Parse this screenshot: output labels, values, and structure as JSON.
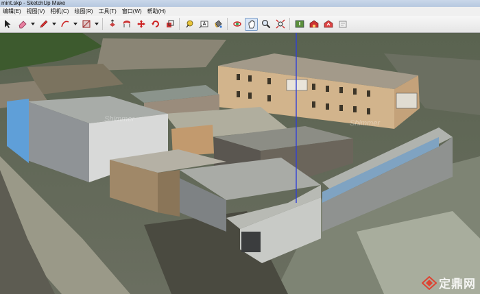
{
  "window": {
    "title": "mint.skp - SketchUp Make"
  },
  "menu": [
    "编辑(E)",
    "视图(V)",
    "相机(C)",
    "绘图(R)",
    "工具(T)",
    "窗口(W)",
    "帮助(H)"
  ],
  "toolbar": {
    "icons": [
      "select-icon",
      "eraser-icon",
      "pencil-icon",
      "arc-icon",
      "rectangle-icon",
      "push-pull-icon",
      "follow-me-icon",
      "move-icon",
      "rotate-icon",
      "scale-icon",
      "tape-measure-icon",
      "text-icon",
      "paint-bucket-icon",
      "orbit-icon",
      "pan-icon",
      "zoom-icon",
      "zoom-extents-icon",
      "add-location-icon",
      "warehouse-icon",
      "share-model-icon",
      "extension-icon"
    ]
  },
  "viewport": {
    "ghost_labels": [
      "Shimmer",
      "Shimmer"
    ]
  },
  "watermark": {
    "text": "定鼎网"
  }
}
